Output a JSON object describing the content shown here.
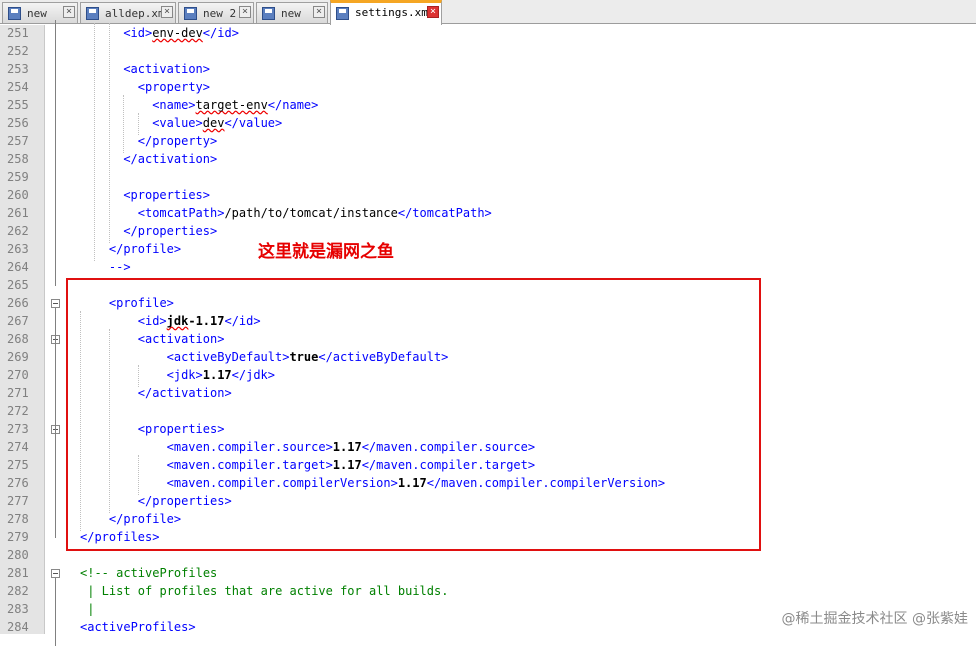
{
  "tabs": [
    {
      "label": "new",
      "active": false
    },
    {
      "label": "alldep.xml",
      "active": false
    },
    {
      "label": "new 2",
      "active": false
    },
    {
      "label": "new",
      "active": false
    },
    {
      "label": "settings.xml",
      "active": true
    }
  ],
  "lines": [
    {
      "n": "251",
      "segs": [
        {
          "t": "<id>",
          "c": "tag"
        },
        {
          "t": "env-dev",
          "c": "txt",
          "w": 1
        },
        {
          "t": "</id>",
          "c": "tag"
        }
      ]
    },
    {
      "n": "252",
      "segs": []
    },
    {
      "n": "253",
      "segs": [
        {
          "t": "<activation>",
          "c": "tag"
        }
      ]
    },
    {
      "n": "254",
      "segs": [
        {
          "t": "<property>",
          "c": "tag"
        }
      ]
    },
    {
      "n": "255",
      "segs": [
        {
          "t": "<name>",
          "c": "tag"
        },
        {
          "t": "target-env",
          "c": "txt",
          "w": 1
        },
        {
          "t": "</name>",
          "c": "tag"
        }
      ]
    },
    {
      "n": "256",
      "segs": [
        {
          "t": "<value>",
          "c": "tag"
        },
        {
          "t": "dev",
          "c": "txt",
          "w": 1
        },
        {
          "t": "</value>",
          "c": "tag"
        }
      ]
    },
    {
      "n": "257",
      "segs": [
        {
          "t": "</property>",
          "c": "tag"
        }
      ]
    },
    {
      "n": "258",
      "segs": [
        {
          "t": "</activation>",
          "c": "tag"
        }
      ]
    },
    {
      "n": "259",
      "segs": []
    },
    {
      "n": "260",
      "segs": [
        {
          "t": "<properties>",
          "c": "tag"
        }
      ]
    },
    {
      "n": "261",
      "segs": [
        {
          "t": "<tomcatPath>",
          "c": "tag"
        },
        {
          "t": "/path/to/tomcat/instance",
          "c": "txt"
        },
        {
          "t": "</tomcatPath>",
          "c": "tag"
        }
      ]
    },
    {
      "n": "262",
      "segs": [
        {
          "t": "</properties>",
          "c": "tag"
        }
      ]
    },
    {
      "n": "263",
      "segs": [
        {
          "t": "</profile>",
          "c": "tag"
        }
      ]
    },
    {
      "n": "264",
      "segs": [
        {
          "t": "-->",
          "c": "tag"
        }
      ]
    },
    {
      "n": "265",
      "segs": []
    },
    {
      "n": "266",
      "segs": [
        {
          "t": "<profile>",
          "c": "tag"
        }
      ]
    },
    {
      "n": "267",
      "segs": [
        {
          "t": "<id>",
          "c": "tag"
        },
        {
          "t": "jdk",
          "c": "bold",
          "w": 1
        },
        {
          "t": "-1.17",
          "c": "bold"
        },
        {
          "t": "</id>",
          "c": "tag"
        }
      ]
    },
    {
      "n": "268",
      "segs": [
        {
          "t": "<activation>",
          "c": "tag"
        }
      ]
    },
    {
      "n": "269",
      "segs": [
        {
          "t": "<activeByDefault>",
          "c": "tag"
        },
        {
          "t": "true",
          "c": "bold"
        },
        {
          "t": "</activeByDefault>",
          "c": "tag"
        }
      ]
    },
    {
      "n": "270",
      "segs": [
        {
          "t": "<jdk>",
          "c": "tag"
        },
        {
          "t": "1.17",
          "c": "bold"
        },
        {
          "t": "</jdk>",
          "c": "tag"
        }
      ]
    },
    {
      "n": "271",
      "segs": [
        {
          "t": "</activation>",
          "c": "tag"
        }
      ]
    },
    {
      "n": "272",
      "segs": []
    },
    {
      "n": "273",
      "segs": [
        {
          "t": "<properties>",
          "c": "tag"
        }
      ]
    },
    {
      "n": "274",
      "segs": [
        {
          "t": "<maven.compiler.source>",
          "c": "tag"
        },
        {
          "t": "1.17",
          "c": "bold"
        },
        {
          "t": "</maven.compiler.source>",
          "c": "tag"
        }
      ]
    },
    {
      "n": "275",
      "segs": [
        {
          "t": "<maven.compiler.target>",
          "c": "tag"
        },
        {
          "t": "1.17",
          "c": "bold"
        },
        {
          "t": "</maven.compiler.target>",
          "c": "tag"
        }
      ]
    },
    {
      "n": "276",
      "segs": [
        {
          "t": "<maven.compiler.compilerVersion>",
          "c": "tag"
        },
        {
          "t": "1.17",
          "c": "bold"
        },
        {
          "t": "</maven.compiler.compilerVersion>",
          "c": "tag"
        }
      ]
    },
    {
      "n": "277",
      "segs": [
        {
          "t": "</properties>",
          "c": "tag"
        }
      ]
    },
    {
      "n": "278",
      "segs": [
        {
          "t": "</profile>",
          "c": "tag"
        }
      ]
    },
    {
      "n": "279",
      "segs": [
        {
          "t": "</profiles>",
          "c": "tag"
        }
      ]
    },
    {
      "n": "280",
      "segs": []
    },
    {
      "n": "281",
      "segs": [
        {
          "t": "<!-- activeProfiles",
          "c": "comment"
        }
      ]
    },
    {
      "n": "282",
      "segs": [
        {
          "t": " | List of profiles that are active for all builds.",
          "c": "comment"
        }
      ]
    },
    {
      "n": "283",
      "segs": [
        {
          "t": " |",
          "c": "comment"
        }
      ]
    },
    {
      "n": "284",
      "segs": [
        {
          "t": "<activeProfiles>",
          "c": "tag"
        }
      ]
    }
  ],
  "annotation": "这里就是漏网之鱼",
  "watermark": "@稀土掘金技术社区 @张紫娃",
  "colors": {
    "tag": "#0000ff",
    "comment": "#008000",
    "highlight": "#e01010",
    "active_tab_accent": "#f5a623"
  },
  "icons": {
    "tab_icon": "save-icon",
    "fold": "fold-minus-icon"
  }
}
